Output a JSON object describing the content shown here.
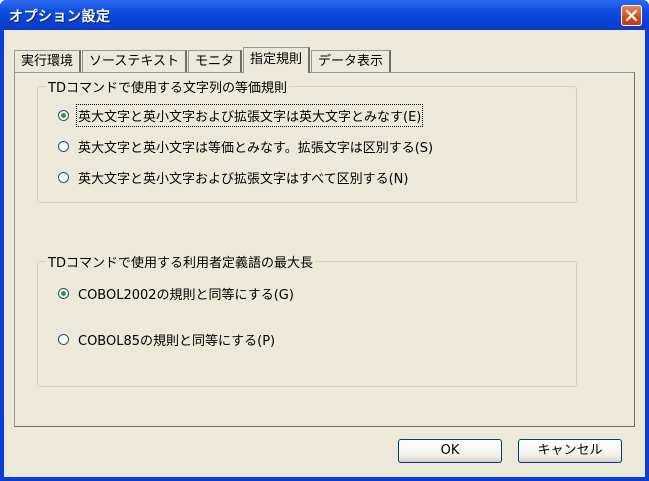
{
  "window": {
    "title": "オプション設定"
  },
  "tabs": [
    {
      "label": "実行環境"
    },
    {
      "label": "ソーステキスト"
    },
    {
      "label": "モニタ"
    },
    {
      "label": "指定規則"
    },
    {
      "label": "データ表示"
    }
  ],
  "active_tab": "指定規則",
  "group1": {
    "title": "TDコマンドで使用する文字列の等価規則",
    "options": [
      {
        "label": "英大文字と英小文字および拡張文字は英大文字とみなす(E)",
        "checked": true
      },
      {
        "label": "英大文字と英小文字は等価とみなす。拡張文字は区別する(S)",
        "checked": false
      },
      {
        "label": "英大文字と英小文字および拡張文字はすべて区別する(N)",
        "checked": false
      }
    ]
  },
  "group2": {
    "title": "TDコマンドで使用する利用者定義語の最大長",
    "options": [
      {
        "label": "COBOL2002の規則と同等にする(G)",
        "checked": true
      },
      {
        "label": "COBOL85の規則と同等にする(P)",
        "checked": false
      }
    ]
  },
  "buttons": {
    "ok": "OK",
    "cancel": "キャンセル"
  }
}
